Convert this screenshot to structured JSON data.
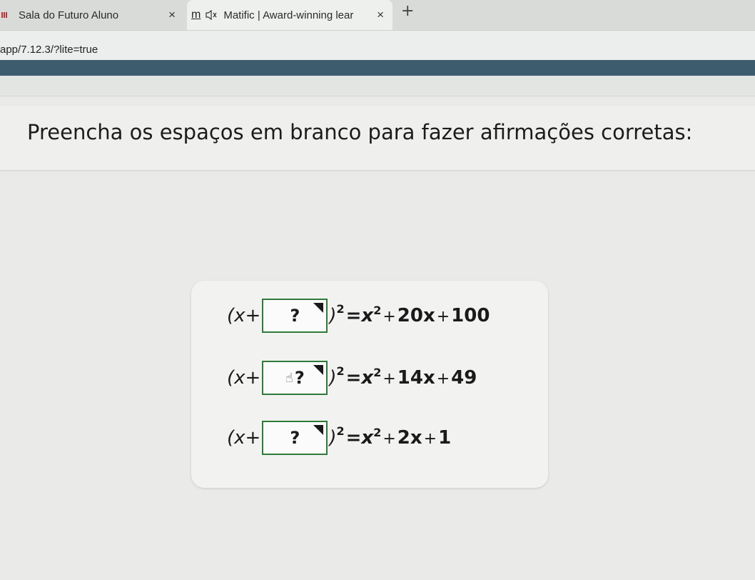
{
  "browser": {
    "tabs": [
      {
        "title": "Sala do Futuro Aluno",
        "icon": "sala-futuro-favicon",
        "close": "×"
      },
      {
        "title": "Matific | Award-winning lear",
        "icon": "matific-m-logo",
        "close": "×",
        "logo_text": "m"
      }
    ],
    "new_tab": "+",
    "url": "app/7.12.3/?lite=true"
  },
  "question": {
    "prompt": "Preencha os espaços em branco para fazer afirmações corretas:"
  },
  "equations": [
    {
      "open": "(x+",
      "blank_placeholder": "?",
      "close": ")",
      "exp": "2",
      "rhs_terms": [
        "=x",
        "2",
        "+",
        "20x",
        "+",
        "100"
      ]
    },
    {
      "open": "(x+",
      "blank_placeholder": "?",
      "close": ")",
      "exp": "2",
      "rhs_terms": [
        "=x",
        "2",
        "+",
        "14x",
        "+",
        "49"
      ]
    },
    {
      "open": "(x+",
      "blank_placeholder": "?",
      "close": ")",
      "exp": "2",
      "rhs_terms": [
        "=x",
        "2",
        "+",
        "2x",
        "+",
        "1"
      ]
    }
  ],
  "colors": {
    "blank_border": "#2f7a3a",
    "accent_strip": "#3d5d6e"
  }
}
